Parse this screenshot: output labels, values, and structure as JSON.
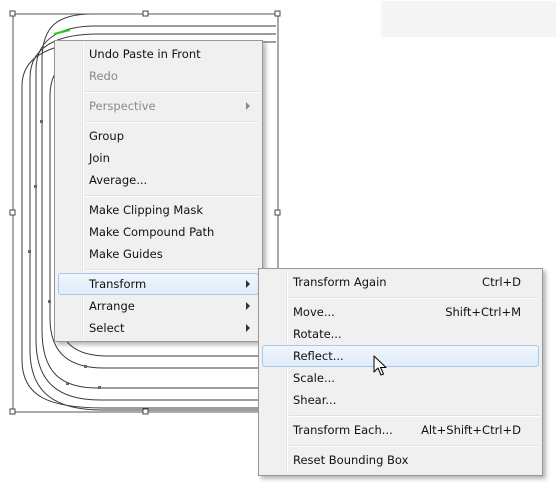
{
  "context_menu": {
    "items": [
      {
        "label": "Undo Paste in Front",
        "enabled": true
      },
      {
        "label": "Redo",
        "enabled": false
      },
      {
        "label": "Perspective",
        "enabled": false,
        "submenu": true
      },
      {
        "label": "Group",
        "enabled": true
      },
      {
        "label": "Join",
        "enabled": true
      },
      {
        "label": "Average...",
        "enabled": true
      },
      {
        "label": "Make Clipping Mask",
        "enabled": true
      },
      {
        "label": "Make Compound Path",
        "enabled": true
      },
      {
        "label": "Make Guides",
        "enabled": true
      },
      {
        "label": "Transform",
        "enabled": true,
        "submenu": true,
        "open": true
      },
      {
        "label": "Arrange",
        "enabled": true,
        "submenu": true
      },
      {
        "label": "Select",
        "enabled": true,
        "submenu": true
      }
    ]
  },
  "transform_submenu": {
    "items": [
      {
        "label": "Transform Again",
        "shortcut": "Ctrl+D"
      },
      {
        "label": "Move...",
        "shortcut": "Shift+Ctrl+M"
      },
      {
        "label": "Rotate...",
        "shortcut": ""
      },
      {
        "label": "Reflect...",
        "shortcut": "",
        "hover": true
      },
      {
        "label": "Scale...",
        "shortcut": ""
      },
      {
        "label": "Shear...",
        "shortcut": ""
      },
      {
        "label": "Transform Each...",
        "shortcut": "Alt+Shift+Ctrl+D"
      },
      {
        "label": "Reset Bounding Box",
        "shortcut": ""
      }
    ]
  },
  "colors": {
    "menu_bg": "#f0f0f0",
    "highlight_border": "#a8c8ec",
    "path_stroke": "#3a3a3a",
    "anchor_green": "#22cc22"
  }
}
